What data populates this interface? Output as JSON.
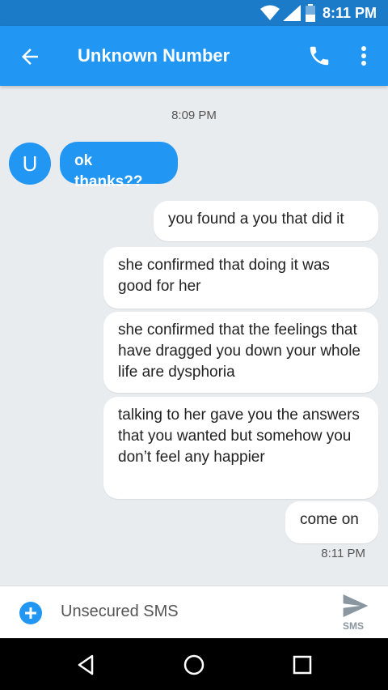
{
  "status_bar": {
    "time": "8:11 PM"
  },
  "app_bar": {
    "title": "Unknown Number"
  },
  "conversation": {
    "timestamp_top": "8:09 PM",
    "avatar_letter": "U",
    "messages": [
      {
        "direction": "incoming",
        "text": "ok thanks??"
      },
      {
        "direction": "outgoing",
        "text": "you found a you that did it"
      },
      {
        "direction": "outgoing",
        "text": "she confirmed that doing it was good for her"
      },
      {
        "direction": "outgoing",
        "text": "she confirmed that the feelings that have dragged you down your whole life are dysphoria"
      },
      {
        "direction": "outgoing",
        "text": "talking to her gave you the answers that you wanted but somehow you don’t feel any happier"
      },
      {
        "direction": "outgoing",
        "text": "come on"
      }
    ],
    "timestamp_bottom": "8:11 PM"
  },
  "compose": {
    "placeholder": "Unsecured SMS",
    "send_label": "SMS"
  },
  "colors": {
    "accent": "#2196f3",
    "status_bar": "#1c7bc9",
    "background": "#e9ecef"
  },
  "icons": [
    "wifi-icon",
    "signal-icon",
    "battery-icon",
    "back-arrow-icon",
    "phone-icon",
    "more-vert-icon",
    "add-circle-icon",
    "send-icon",
    "nav-back-icon",
    "nav-home-icon",
    "nav-recents-icon"
  ]
}
